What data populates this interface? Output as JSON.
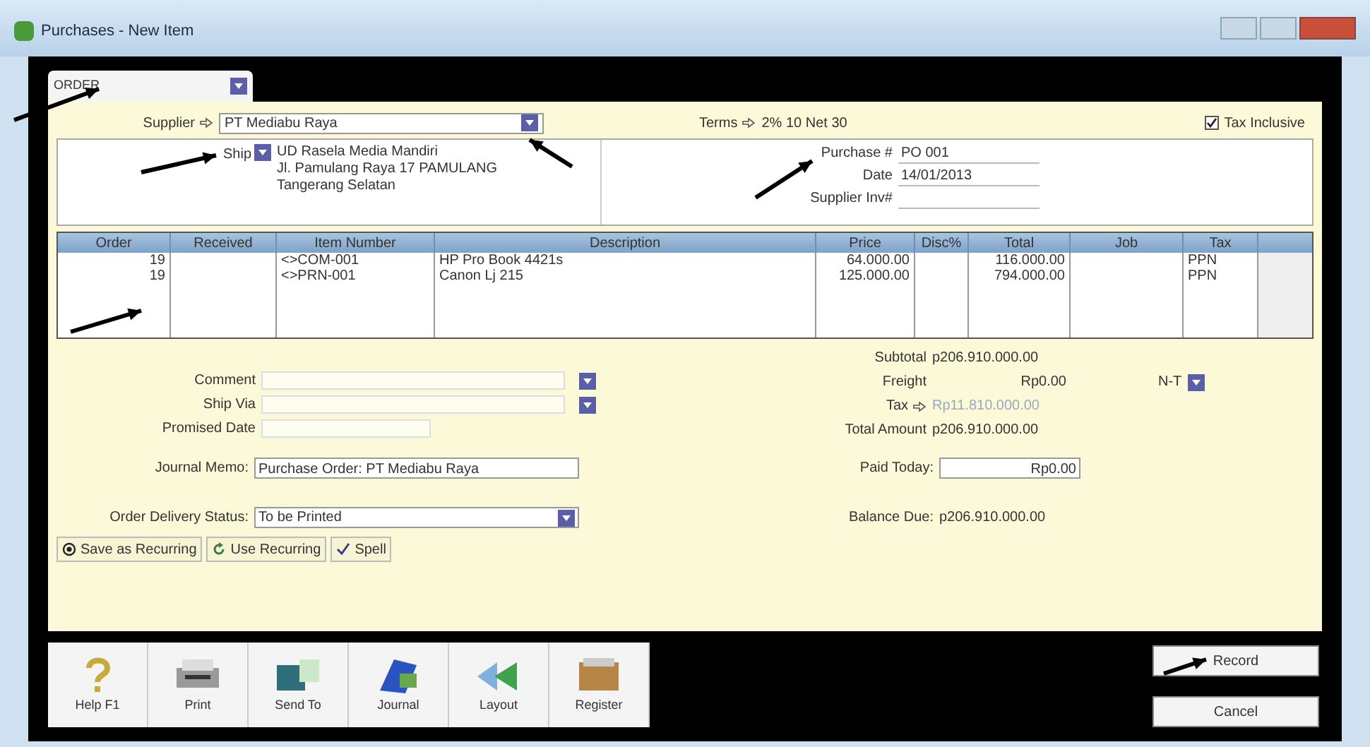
{
  "window": {
    "title": "Purchases - New Item"
  },
  "layout_dropdown": {
    "value": "ORDER"
  },
  "header": {
    "supplier_label": "Supplier",
    "supplier": "PT Mediabu Raya",
    "terms_label": "Terms",
    "terms": "2% 10 Net 30",
    "tax_inclusive": {
      "label": "Tax Inclusive",
      "checked": true
    }
  },
  "ship_to": {
    "label": "Ship",
    "lines": [
      "UD Rasela Media Mandiri",
      "Jl. Pamulang Raya 17 PAMULANG",
      "Tangerang Selatan"
    ]
  },
  "purchase_fields": [
    {
      "label": "Purchase #",
      "value": "PO 001"
    },
    {
      "label": "Date",
      "value": "14/01/2013"
    },
    {
      "label": "Supplier Inv#"
    }
  ],
  "table": {
    "columns": [
      "Order",
      "Received",
      "Item Number",
      "Description",
      "Price",
      "Disc%",
      "Total",
      "Job",
      "Tax"
    ],
    "rows": [
      [
        "19",
        "",
        "<>COM-001",
        "HP Pro Book 4421s",
        "64.000.00",
        "",
        "116.000.00",
        "",
        "PPN"
      ],
      [
        "19",
        "",
        "<>PRN-001",
        "Canon Lj 215",
        "125.000.00",
        "",
        "794.000.00",
        "",
        "PPN"
      ]
    ]
  },
  "left_fields": [
    {
      "label": "Comment",
      "kind": "dropdown"
    },
    {
      "label": "Ship Via",
      "kind": "dropdown"
    },
    {
      "label": "Promised Date",
      "kind": "text"
    }
  ],
  "totals": [
    {
      "label": "Subtotal",
      "value": "p206.910.000.00",
      "kind": "plain"
    },
    {
      "label": "Freight",
      "value": "Rp0.00",
      "kind": "freight",
      "tax_code": "N-T"
    },
    {
      "label": "Tax",
      "value": "Rp11.810.000.00",
      "kind": "tax"
    },
    {
      "label": "Total Amount",
      "value": "p206.910.000.00",
      "kind": "plain"
    }
  ],
  "journal_memo": {
    "label": "Journal Memo:",
    "value": "Purchase Order: PT Mediabu Raya"
  },
  "delivery_status": {
    "label": "Order Delivery Status:",
    "value": "To be Printed"
  },
  "paid_today": {
    "label": "Paid Today:",
    "value": "Rp0.00"
  },
  "balance_due": {
    "label": "Balance Due:",
    "value": "p206.910.000.00"
  },
  "recurring_buttons": [
    {
      "label": "Save as Recurring",
      "kind": "save"
    },
    {
      "label": "Use Recurring",
      "kind": "use"
    },
    {
      "label": "Spell",
      "kind": "spell"
    }
  ],
  "toolbar": [
    {
      "label": "Help F1",
      "kind": "help"
    },
    {
      "label": "Print",
      "kind": "print"
    },
    {
      "label": "Send To",
      "kind": "send"
    },
    {
      "label": "Journal",
      "kind": "journal"
    },
    {
      "label": "Layout",
      "kind": "layout"
    },
    {
      "label": "Register",
      "kind": "register"
    }
  ],
  "actions": [
    "Record",
    "Cancel"
  ]
}
